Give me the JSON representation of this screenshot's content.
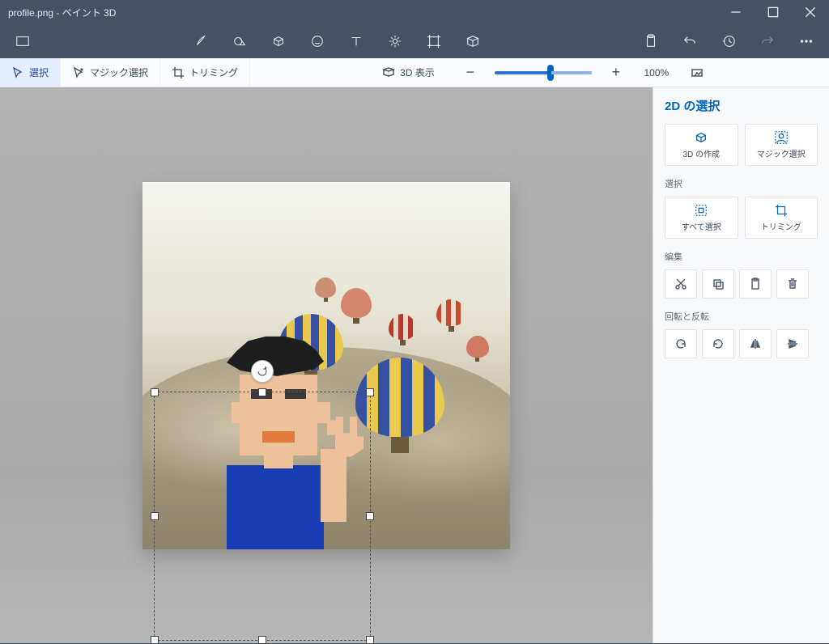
{
  "titlebar": {
    "title": "profile.png - ペイント 3D"
  },
  "subbar": {
    "select": "選択",
    "magic_select": "マジック選択",
    "crop": "トリミング",
    "view3d": "3D 表示",
    "zoom_pct": "100%"
  },
  "panel": {
    "title": "2D の選択",
    "create3d": "3D の作成",
    "magic": "マジック選択",
    "section_select": "選択",
    "select_all": "すべて選択",
    "crop": "トリミング",
    "section_edit": "編集",
    "section_rotflip": "回転と反転"
  }
}
